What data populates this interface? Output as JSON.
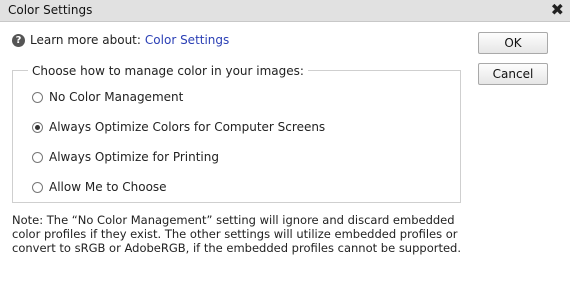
{
  "window": {
    "title": "Color Settings",
    "close_glyph": "✕"
  },
  "learn_more": {
    "prefix": "Learn more about:",
    "link": "Color Settings",
    "icon": "help-icon"
  },
  "buttons": {
    "ok": "OK",
    "cancel": "Cancel"
  },
  "group": {
    "legend": "Choose how to manage color in your images:",
    "options": [
      {
        "label": "No Color Management",
        "checked": false
      },
      {
        "label": "Always Optimize Colors for Computer Screens",
        "checked": true
      },
      {
        "label": "Always Optimize for Printing",
        "checked": false
      },
      {
        "label": "Allow Me to Choose",
        "checked": false
      }
    ]
  },
  "note": "Note: The “No Color Management” setting will ignore and discard embedded color profiles if they exist. The other settings will utilize embedded profiles or convert to sRGB or AdobeRGB, if the embedded profiles cannot be supported."
}
